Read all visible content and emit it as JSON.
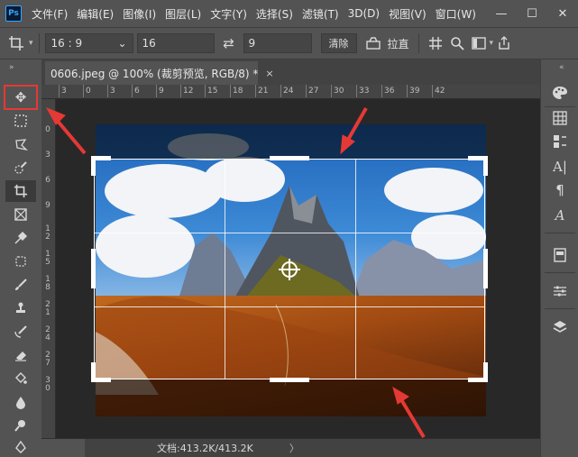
{
  "app": {
    "logo": "Ps"
  },
  "menu": [
    "文件(F)",
    "编辑(E)",
    "图像(I)",
    "图层(L)",
    "文字(Y)",
    "选择(S)",
    "滤镜(T)",
    "3D(D)",
    "视图(V)",
    "窗口(W)"
  ],
  "window_controls": {
    "minimize": "—",
    "maximize": "☐",
    "close": "✕"
  },
  "options": {
    "ratio_select": "16 : 9",
    "width_value": "16",
    "height_value": "9",
    "clear_label": "清除",
    "straighten_label": "拉直"
  },
  "document": {
    "tab_title": "0606.jpeg @ 100% (裁剪预览, RGB/8) *",
    "tab_close": "×"
  },
  "ruler": {
    "top_ticks": [
      "3",
      "0",
      "3",
      "6",
      "9",
      "12",
      "15",
      "18",
      "21",
      "24",
      "27",
      "30",
      "33",
      "36",
      "39",
      "42"
    ],
    "left_ticks": [
      "0",
      "3",
      "6",
      "9",
      "1\n2",
      "1\n5",
      "1\n8",
      "2\n1",
      "2\n4",
      "2\n7",
      "3\n0"
    ]
  },
  "status": {
    "doc_info": "文档:413.2K/413.2K",
    "arrow": "〉"
  },
  "icons": {
    "tools": [
      "move-icon",
      "marquee-icon",
      "lasso-icon",
      "quick-select-icon",
      "crop-icon",
      "frame-icon",
      "eyedropper-icon",
      "healing-brush-icon",
      "brush-icon",
      "stamp-icon",
      "history-brush-icon",
      "eraser-icon",
      "paint-bucket-icon",
      "blur-icon",
      "dodge-icon",
      "pen-icon"
    ],
    "panels": [
      "color-palette-icon",
      "swatches-icon",
      "brush-settings-icon",
      "character-icon",
      "paragraph-icon",
      "glyphs-icon",
      "libraries-icon",
      "adjustments-icon",
      "layers-icon"
    ]
  },
  "colors": {
    "highlight": "#e53935",
    "annotation_arrow": "#e53935",
    "panel_bg": "#535353",
    "canvas_bg": "#282828"
  }
}
